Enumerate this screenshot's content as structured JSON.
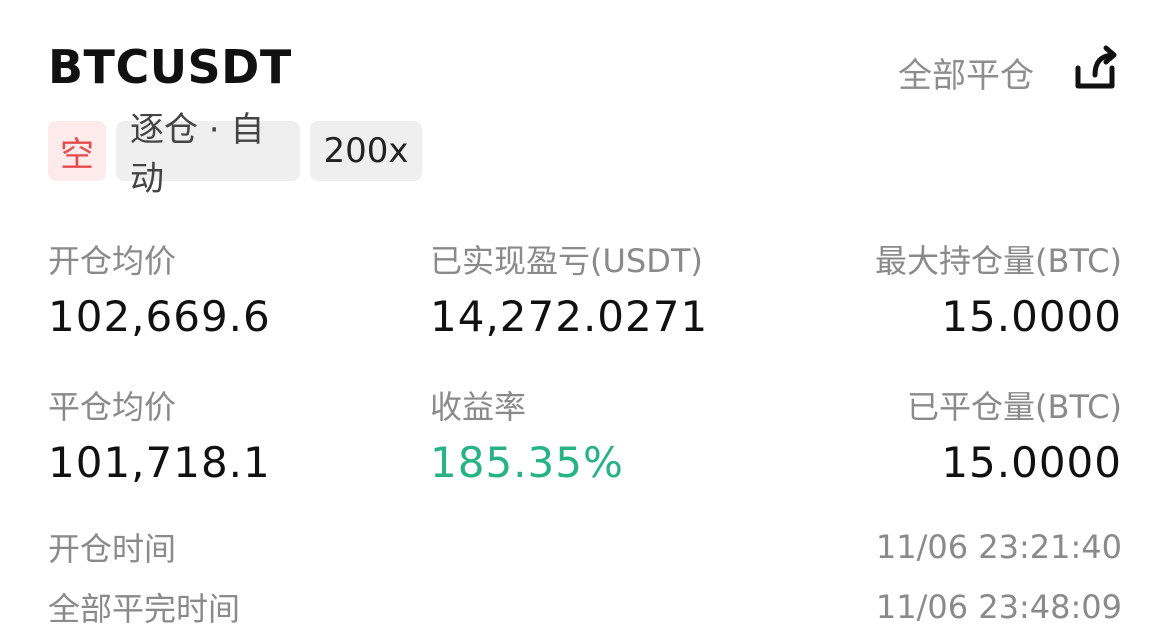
{
  "header": {
    "symbol": "BTCUSDT",
    "close_all_label": "全部平仓",
    "share_icon": "share-icon"
  },
  "tags": {
    "direction": "空",
    "margin_mode": "逐仓 · 自动",
    "leverage": "200x"
  },
  "stats": {
    "open_price": {
      "label": "开仓均价",
      "value": "102,669.6"
    },
    "realized_pnl": {
      "label": "已实现盈亏(USDT)",
      "value": "14,272.0271"
    },
    "max_position": {
      "label": "最大持仓量(BTC)",
      "value": "15.0000"
    },
    "close_price": {
      "label": "平仓均价",
      "value": "101,718.1"
    },
    "return_rate": {
      "label": "收益率",
      "value": "185.35%"
    },
    "closed_amount": {
      "label": "已平仓量(BTC)",
      "value": "15.0000"
    }
  },
  "times": {
    "open_time": {
      "label": "开仓时间",
      "value": "11/06 23:21:40"
    },
    "close_time": {
      "label": "全部平完时间",
      "value": "11/06 23:48:09"
    }
  },
  "colors": {
    "positive": "#27b383",
    "short": "#e54b4b",
    "muted": "#8a8a8a"
  }
}
